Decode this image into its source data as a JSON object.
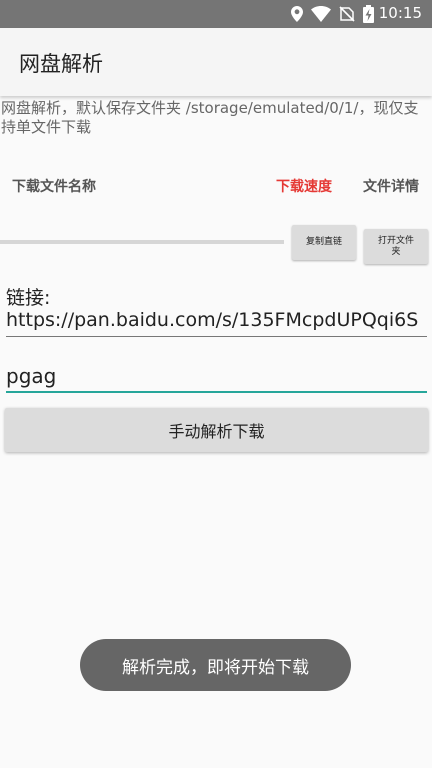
{
  "status_bar": {
    "time": "10:15",
    "icons": [
      "location-icon",
      "wifi-icon",
      "no-sim-icon",
      "battery-charging-icon"
    ]
  },
  "app_bar": {
    "title": "网盘解析"
  },
  "info_text": "网盘解析，默认保存文件夹 /storage/emulated/0/1/，现仅支持单文件下载",
  "download_row": {
    "name_header": "下载文件名称",
    "speed_header": "下载速度",
    "detail_header": "文件详情",
    "progress": 0,
    "copy_button": "复制直链",
    "open_folder_button": "打开文件夹"
  },
  "link": {
    "label": "链接:",
    "value": "https://pan.baidu.com/s/135FMcpdUPQqi6S"
  },
  "code_input": {
    "value": "pgag"
  },
  "manual_button": "手动解析下载",
  "toast": "解析完成，即将开始下载",
  "colors": {
    "status_bar": "#757575",
    "accent": "#26a69a",
    "speed_red": "#e53935",
    "toast_bg": "#666666"
  }
}
